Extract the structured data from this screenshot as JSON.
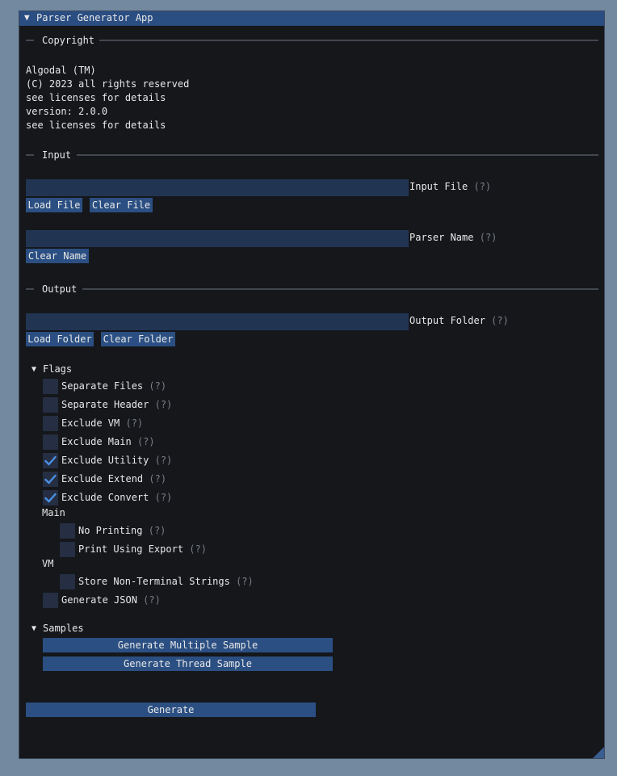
{
  "window": {
    "title": "Parser Generator App"
  },
  "copyright": {
    "header": "Copyright",
    "lines": [
      "Algodal (TM)",
      "(C) 2023 all rights reserved",
      "see licenses for details",
      "version: 2.0.0",
      "see licenses for details"
    ]
  },
  "input": {
    "header": "Input",
    "input_file": {
      "value": "",
      "label": "Input File",
      "help": "(?)"
    },
    "load_file_label": "Load File",
    "clear_file_label": "Clear File",
    "parser_name": {
      "value": "",
      "label": "Parser Name",
      "help": "(?)"
    },
    "clear_name_label": "Clear Name"
  },
  "output": {
    "header": "Output",
    "output_folder": {
      "value": "",
      "label": "Output Folder",
      "help": "(?)"
    },
    "load_folder_label": "Load Folder",
    "clear_folder_label": "Clear Folder"
  },
  "flags": {
    "label": "Flags",
    "items": [
      {
        "label": "Separate Files",
        "help": "(?)",
        "checked": false
      },
      {
        "label": "Separate Header",
        "help": "(?)",
        "checked": false
      },
      {
        "label": "Exclude VM",
        "help": "(?)",
        "checked": false
      },
      {
        "label": "Exclude Main",
        "help": "(?)",
        "checked": false
      },
      {
        "label": "Exclude Utility",
        "help": "(?)",
        "checked": true
      },
      {
        "label": "Exclude Extend",
        "help": "(?)",
        "checked": true
      },
      {
        "label": "Exclude Convert",
        "help": "(?)",
        "checked": true
      }
    ],
    "main_group": {
      "label": "Main",
      "items": [
        {
          "label": "No Printing",
          "help": "(?)",
          "checked": false
        },
        {
          "label": "Print Using Export",
          "help": "(?)",
          "checked": false
        }
      ]
    },
    "vm_group": {
      "label": "VM",
      "items": [
        {
          "label": "Store Non-Terminal Strings",
          "help": "(?)",
          "checked": false
        }
      ]
    },
    "generate_json": {
      "label": "Generate JSON",
      "help": "(?)",
      "checked": false
    }
  },
  "samples": {
    "label": "Samples",
    "multiple_label": "Generate Multiple Sample",
    "thread_label": "Generate Thread Sample"
  },
  "generate_label": "Generate",
  "colors": {
    "background": "#7289A0",
    "window": "#15171B",
    "titlebar": "#2A4D82",
    "button": "#2B4F82",
    "input": "#213553",
    "checkbox": "#252E42",
    "checkmark": "#4A90E2"
  }
}
